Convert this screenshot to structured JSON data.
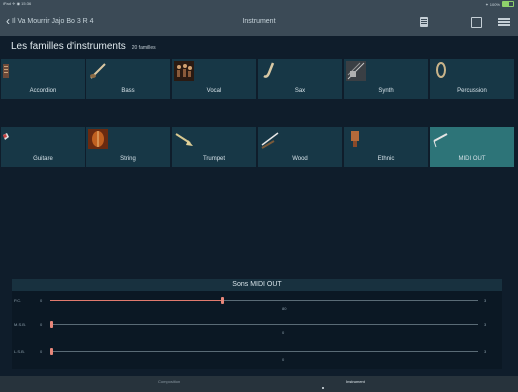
{
  "status": {
    "left": "iPad ✈ ◉ 15:36",
    "right": "✦ 100% "
  },
  "nav": {
    "back_label": "Il Va Mourrir Jajo Bo 3 R 4",
    "title": "Instrument"
  },
  "families": {
    "title": "Les familles d'instruments",
    "count": "20 familles"
  },
  "tiles": [
    {
      "label": "Accordion",
      "icon": "accordion-icon"
    },
    {
      "label": "Bass",
      "icon": "bass-icon"
    },
    {
      "label": "Vocal",
      "icon": "vocal-icon"
    },
    {
      "label": "Sax",
      "icon": "sax-icon"
    },
    {
      "label": "Synth",
      "icon": "synth-icon"
    },
    {
      "label": "Percussion",
      "icon": "percussion-icon"
    },
    {
      "label": "Guitare",
      "icon": "guitar-icon"
    },
    {
      "label": "String",
      "icon": "string-icon"
    },
    {
      "label": "Trumpet",
      "icon": "trumpet-icon"
    },
    {
      "label": "Wood",
      "icon": "wood-icon"
    },
    {
      "label": "Ethnic",
      "icon": "ethnic-icon"
    },
    {
      "label": "MIDI OUT",
      "icon": "midi-out-icon",
      "selected": true
    }
  ],
  "panel": {
    "title": "Sons MIDI OUT",
    "sliders": [
      {
        "name": "P.C.",
        "min": "0",
        "max": "3",
        "value_label": "80",
        "fraction": 0.4
      },
      {
        "name": "M.S.B.",
        "min": "0",
        "max": "3",
        "value_label": "0",
        "fraction": 0.0
      },
      {
        "name": "L.S.B.",
        "min": "0",
        "max": "3",
        "value_label": "0",
        "fraction": 0.0
      }
    ]
  },
  "tabbar": {
    "tab1": "Composition",
    "tab2": "Instrument"
  },
  "colors": {
    "accent": "#2d7478",
    "tile": "#173746",
    "slider": "#e07a6e"
  }
}
